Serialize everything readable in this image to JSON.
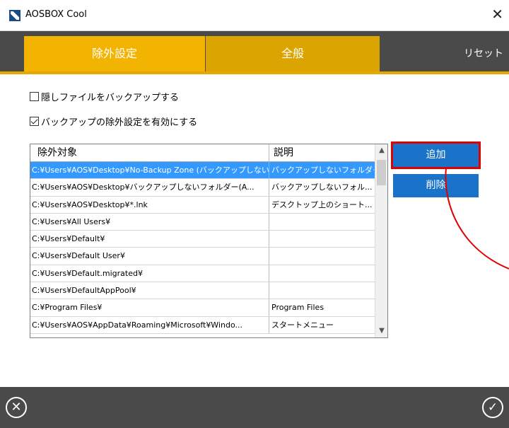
{
  "window": {
    "title": "AOSBOX Cool",
    "close_glyph": "✕",
    "app_icon": "aosbox-logo-icon"
  },
  "tabs": {
    "exclude_label": "除外設定",
    "general_label": "全般",
    "reset_label": "リセット"
  },
  "options": {
    "hidden_files_label": "隠しファイルをバックアップする",
    "hidden_files_checked": false,
    "exclusion_enabled_label": "バックアップの除外設定を有効にする",
    "exclusion_enabled_checked": true
  },
  "grid": {
    "headers": {
      "target": "除外対象",
      "description": "説明"
    },
    "rows": [
      {
        "target": "C:¥Users¥AOS¥Desktop¥No-Backup Zone (バックアップしないフォルダー)",
        "description": "バックアップしないフォルダー",
        "selected": true
      },
      {
        "target": "C:¥Users¥AOS¥Desktop¥バックアップしないフォルダー(A...",
        "description": "バックアップしないフォル..."
      },
      {
        "target": "C:¥Users¥AOS¥Desktop¥*.lnk",
        "description": "デスクトップ上のショート..."
      },
      {
        "target": "C:¥Users¥All Users¥",
        "description": ""
      },
      {
        "target": "C:¥Users¥Default¥",
        "description": ""
      },
      {
        "target": "C:¥Users¥Default User¥",
        "description": ""
      },
      {
        "target": "C:¥Users¥Default.migrated¥",
        "description": ""
      },
      {
        "target": "C:¥Users¥DefaultAppPool¥",
        "description": ""
      },
      {
        "target": "C:¥Program Files¥",
        "description": "Program Files"
      },
      {
        "target": "C:¥Users¥AOS¥AppData¥Roaming¥Microsoft¥Windo...",
        "description": "スタートメニュー"
      }
    ],
    "scroll_up_glyph": "▲",
    "scroll_down_glyph": "▼"
  },
  "buttons": {
    "add_label": "追加",
    "delete_label": "削除"
  },
  "footer": {
    "cancel_glyph": "✕",
    "ok_glyph": "✓"
  },
  "colors": {
    "accent_orange": "#f2b400",
    "dark_bar": "#4a4a4a",
    "button_blue": "#1a73c8",
    "selection_blue": "#3399ff",
    "annotation_red": "#e00000"
  }
}
